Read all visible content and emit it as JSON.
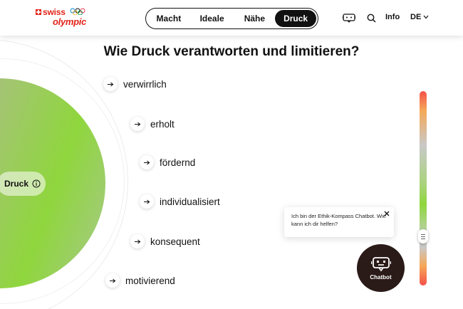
{
  "header": {
    "logo": {
      "line1": "swiss",
      "line2": "olympic"
    },
    "tabs": [
      {
        "label": "Macht"
      },
      {
        "label": "Ideale"
      },
      {
        "label": "Nähe"
      },
      {
        "label": "Druck",
        "active": true
      }
    ],
    "chat_icon": "chatbot-icon",
    "search_icon": "search-icon",
    "info_label": "Info",
    "lang_label": "DE"
  },
  "main": {
    "title": "Wie Druck verantworten und limitieren?",
    "center_label": "Druck",
    "options": [
      {
        "label": "verwirrlich"
      },
      {
        "label": "erholt"
      },
      {
        "label": "fördernd"
      },
      {
        "label": "individualisiert"
      },
      {
        "label": "konsequent"
      },
      {
        "label": "motivierend"
      }
    ]
  },
  "chat": {
    "message": "Ich bin der Ethik-Kompass Chatbot. Wie kann ich dir helfen?",
    "button_label": "Chatbot"
  },
  "colors": {
    "brand_red": "#e2231a",
    "circle_green": "#8fd63d",
    "chat_dark": "#2a1a18"
  }
}
